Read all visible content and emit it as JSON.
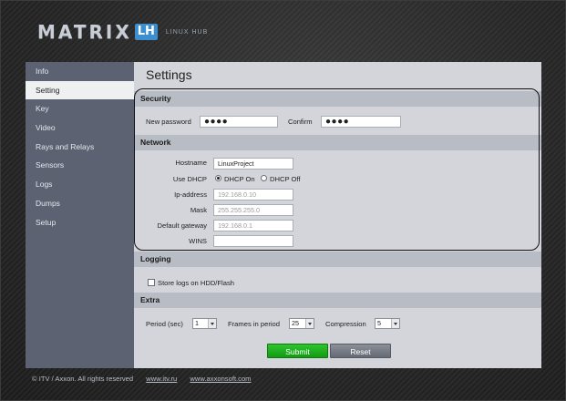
{
  "brand": {
    "name": "MATRIX",
    "badge": "LH",
    "subtitle": "LINUX HUB"
  },
  "sidebar": {
    "items": [
      {
        "label": "Info"
      },
      {
        "label": "Setting",
        "active": true
      },
      {
        "label": "Key"
      },
      {
        "label": "Video"
      },
      {
        "label": "Rays and Relays"
      },
      {
        "label": "Sensors"
      },
      {
        "label": "Logs"
      },
      {
        "label": "Dumps"
      },
      {
        "label": "Setup"
      }
    ]
  },
  "page": {
    "title": "Settings"
  },
  "security": {
    "heading": "Security",
    "new_password_label": "New password",
    "new_password_value": "●●●●",
    "confirm_label": "Confirm",
    "confirm_value": "●●●●"
  },
  "network": {
    "heading": "Network",
    "hostname_label": "Hostname",
    "hostname_value": "LinuxProject",
    "dhcp_label": "Use DHCP",
    "dhcp_on_label": "DHCP On",
    "dhcp_off_label": "DHCP Off",
    "dhcp_selected": "on",
    "ip_label": "Ip-address",
    "ip_value": "192.168.0.10",
    "mask_label": "Mask",
    "mask_value": "255.255.255.0",
    "gateway_label": "Default gateway",
    "gateway_value": "192.168.0.1",
    "wins_label": "WINS",
    "wins_value": ""
  },
  "logging": {
    "heading": "Logging",
    "store_logs_label": "Store logs on HDD/Flash",
    "store_logs_checked": false
  },
  "extra": {
    "heading": "Extra",
    "period_label": "Period (sec)",
    "period_value": "1",
    "frames_label": "Frames in period",
    "frames_value": "25",
    "compression_label": "Compression",
    "compression_value": "5"
  },
  "actions": {
    "submit_label": "Submit",
    "reset_label": "Reset"
  },
  "footer": {
    "copyright": "© ITV / Axxon. All rights reserved",
    "link1": "www.itv.ru",
    "link2": "www.axxonsoft.com"
  },
  "colors": {
    "sidebar_bg": "#5c6272",
    "panel_bg": "#d3d5da",
    "section_head_bg": "#b8bcc4",
    "submit_green": "#1fae1f",
    "brand_badge": "#3b8fd1"
  }
}
